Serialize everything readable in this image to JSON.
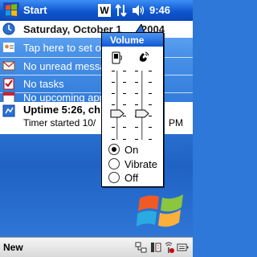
{
  "titlebar": {
    "start_label": "Start",
    "w_label": "W",
    "time": "9:46",
    "icons": [
      "windows-flag-icon",
      "connectivity-icon",
      "speaker-icon"
    ]
  },
  "today": {
    "date": "Saturday, October 1",
    "date_suffix": "2004",
    "owner_info": "Tap here to set o",
    "messages": "No unread messa",
    "tasks": "No tasks",
    "appointments": "No upcoming app",
    "uptime_line1": "Uptime 5:26, ch",
    "uptime_line2": "Timer started 10/",
    "uptime_suffix": "PM",
    "icons": [
      "clock-icon",
      "owner-info-icon",
      "envelope-icon",
      "tasks-checkbox-icon",
      "calendar-icon",
      "uptime-icon",
      "windows-logo-icon"
    ]
  },
  "volume_popup": {
    "title": "Volume",
    "system_volume": 0.38,
    "ringer_volume": 0.38,
    "options": [
      {
        "label": "On",
        "selected": true
      },
      {
        "label": "Vibrate",
        "selected": false
      },
      {
        "label": "Off",
        "selected": false
      }
    ],
    "icons": [
      "system-sound-icon",
      "ringer-phone-icon"
    ]
  },
  "menubar": {
    "new_label": "New",
    "tray_icons": [
      "connectivity-tray-icon",
      "phone-tray-icon",
      "wireless-tray-icon",
      "keyboard-tray-icon"
    ]
  },
  "colors": {
    "titlebar": "#0f56cf",
    "today_background": "#2f79d9",
    "menubar": "#e3e3e3"
  }
}
